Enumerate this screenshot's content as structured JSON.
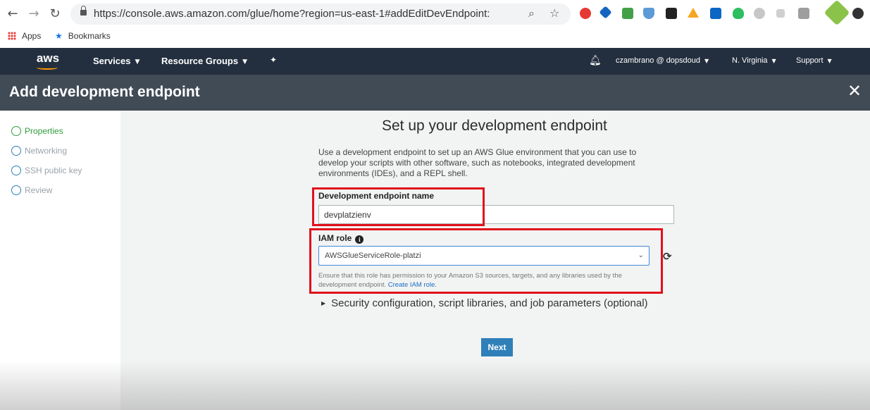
{
  "browser": {
    "url": "https://console.aws.amazon.com/glue/home?region=us-east-1#addEditDevEndpoint:",
    "bookmarks": [
      "Apps",
      "Bookmarks"
    ]
  },
  "aws_nav": {
    "logo": "aws",
    "services": "Services",
    "resource_groups": "Resource Groups",
    "account": "czambrano @ dopsdoud",
    "region": "N. Virginia",
    "support": "Support"
  },
  "header": {
    "title": "Add development endpoint"
  },
  "steps": [
    {
      "label": "Properties",
      "active": true
    },
    {
      "label": "Networking",
      "active": false
    },
    {
      "label": "SSH public key",
      "active": false
    },
    {
      "label": "Review",
      "active": false
    }
  ],
  "main": {
    "title": "Set up your development endpoint",
    "intro": "Use a development endpoint to set up an AWS Glue environment that you can use to develop your scripts with other software, such as notebooks, integrated development environments (IDEs), and a REPL shell.",
    "endpoint_name_label": "Development endpoint name",
    "endpoint_name_value": "devplatzienv",
    "iam_role_label": "IAM role",
    "iam_role_value": "AWSGlueServiceRole-platzi",
    "iam_help": "Ensure that this role has permission to your Amazon S3 sources, targets, and any libraries used by the development endpoint.",
    "iam_help_link": "Create IAM role.",
    "expander_label": "Security configuration, script libraries, and job parameters (optional)",
    "next_label": "Next"
  },
  "colors": {
    "aws_nav_bg": "#232f3e",
    "header_bg": "#414b56",
    "active_step": "#2e9e3a",
    "primary_button": "#2f7fb8",
    "annotation_red": "#e0111b"
  },
  "icons": [
    "back-arrow-icon",
    "forward-arrow-icon",
    "reload-icon",
    "lock-icon",
    "zoom-icon",
    "bookmark-star-icon",
    "bell-icon",
    "pin-icon",
    "close-icon",
    "info-icon",
    "chevron-down-icon",
    "refresh-icon",
    "caret-right-icon"
  ]
}
